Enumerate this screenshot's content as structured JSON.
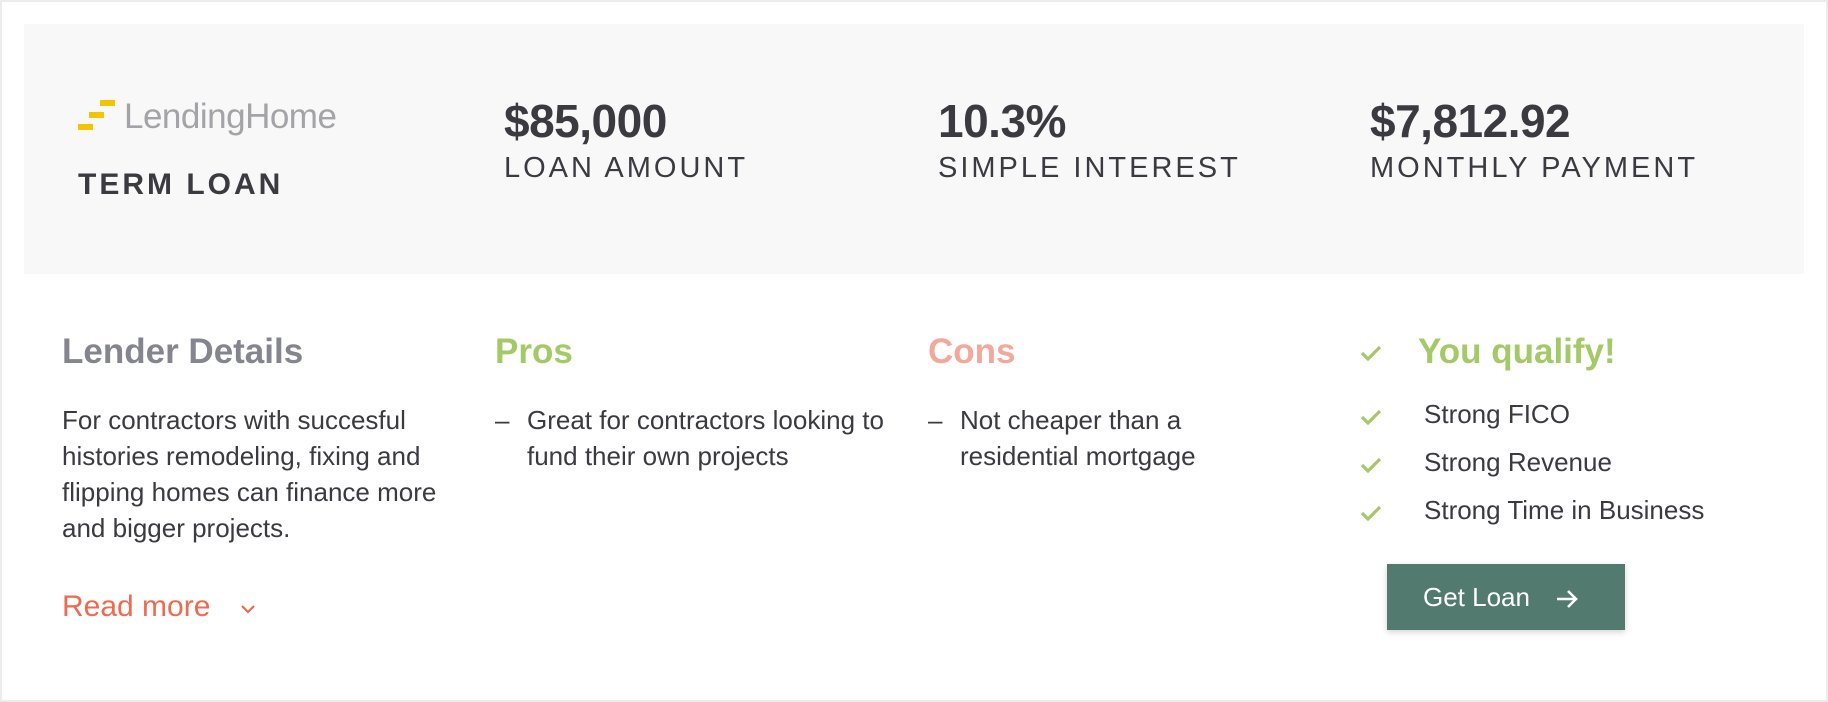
{
  "brand": {
    "logo_text": "LendingHome",
    "logo_color": "#f5c400"
  },
  "summary": {
    "loan_type": "TERM LOAN",
    "stats": [
      {
        "value": "$85,000",
        "label": "LOAN AMOUNT"
      },
      {
        "value": "10.3%",
        "label": "SIMPLE INTEREST"
      },
      {
        "value": "$7,812.92",
        "label": "MONTHLY PAYMENT"
      }
    ]
  },
  "lender_details": {
    "title": "Lender Details",
    "body": "For contractors with succesful histories remodeling, fixing and flipping homes can finance more and bigger projects.",
    "read_more": "Read more",
    "read_more_icon": "chevron-down-icon"
  },
  "pros": {
    "title": "Pros",
    "items": [
      "Great for contractors looking to fund their own projects"
    ],
    "color": "#a4c967"
  },
  "cons": {
    "title": "Cons",
    "items": [
      "Not cheaper than a residential mortgage"
    ],
    "color": "#f2a89a"
  },
  "qualification": {
    "title": "You qualify!",
    "icon": "check-icon",
    "items": [
      "Strong FICO",
      "Strong Revenue",
      "Strong Time in Business"
    ],
    "color": "#a4c967"
  },
  "cta": {
    "label": "Get Loan",
    "icon": "arrow-right-icon",
    "color": "#527a6e"
  }
}
